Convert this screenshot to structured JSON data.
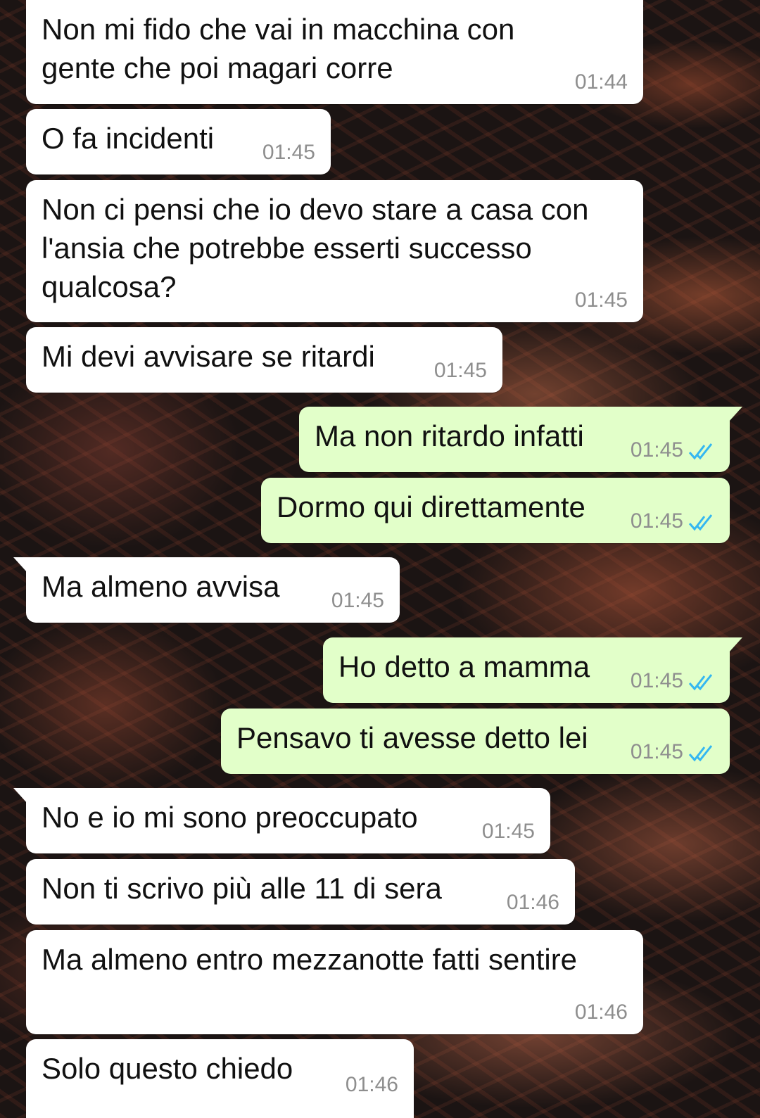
{
  "colors": {
    "incoming_bubble": "#ffffff",
    "outgoing_bubble": "#e2ffc9",
    "timestamp": "#8e8e8e",
    "read_ticks": "#34b7f1"
  },
  "messages": [
    {
      "direction": "incoming",
      "text": "Non mi fido che vai in macchina con\ngente che poi magari corre",
      "time": "01:44"
    },
    {
      "direction": "incoming",
      "text": "O fa incidenti",
      "time": "01:45"
    },
    {
      "direction": "incoming",
      "text": "Non ci pensi che io devo stare a casa con\nl'ansia che potrebbe esserti successo\nqualcosa?",
      "time": "01:45"
    },
    {
      "direction": "incoming",
      "text": "Mi devi avvisare se ritardi",
      "time": "01:45"
    },
    {
      "direction": "outgoing",
      "text": "Ma non ritardo infatti",
      "time": "01:45",
      "status": "double-check-read-icon"
    },
    {
      "direction": "outgoing",
      "text": "Dormo qui direttamente",
      "time": "01:45",
      "status": "double-check-read-icon"
    },
    {
      "direction": "incoming",
      "text": "Ma almeno avvisa",
      "time": "01:45"
    },
    {
      "direction": "outgoing",
      "text": "Ho detto a mamma",
      "time": "01:45",
      "status": "double-check-read-icon"
    },
    {
      "direction": "outgoing",
      "text": "Pensavo ti avesse detto lei",
      "time": "01:45",
      "status": "double-check-read-icon"
    },
    {
      "direction": "incoming",
      "text": "No e io mi sono preoccupato",
      "time": "01:45"
    },
    {
      "direction": "incoming",
      "text": "Non ti scrivo più alle 11 di sera",
      "time": "01:46"
    },
    {
      "direction": "incoming",
      "text": "Ma almeno entro mezzanotte fatti sentire",
      "time": "01:46"
    },
    {
      "direction": "incoming",
      "text": "Solo questo chiedo",
      "time": "01:46"
    }
  ]
}
